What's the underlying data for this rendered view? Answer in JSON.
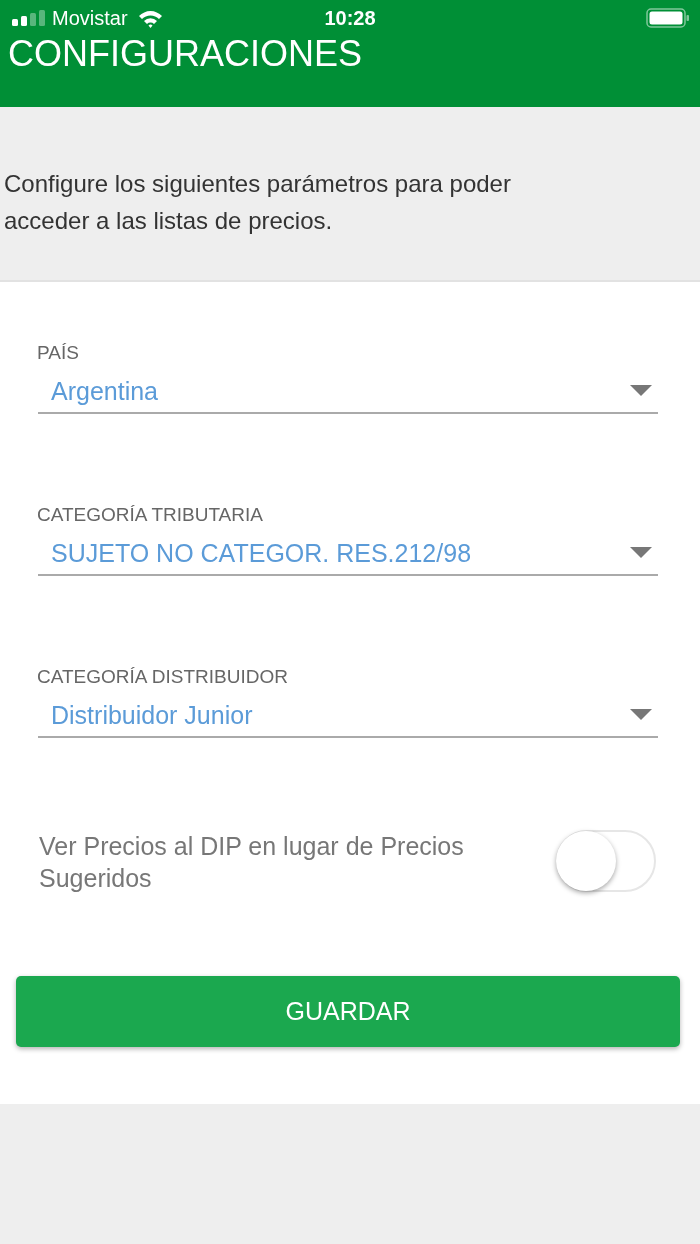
{
  "status_bar": {
    "carrier": "Movistar",
    "time": "10:28"
  },
  "header": {
    "title": "CONFIGURACIONES"
  },
  "intro": "Configure los siguientes parámetros para poder acceder a las listas de precios.",
  "fields": [
    {
      "label": "PAÍS",
      "value": "Argentina"
    },
    {
      "label": "CATEGORÍA TRIBUTARIA",
      "value": "SUJETO NO CATEGOR. RES.212/98"
    },
    {
      "label": "CATEGORÍA DISTRIBUIDOR",
      "value": "Distribuidor Junior"
    }
  ],
  "toggle": {
    "label": "Ver Precios al DIP en lugar de Precios Sugeridos",
    "on": false
  },
  "save_button": {
    "label": "GUARDAR"
  }
}
